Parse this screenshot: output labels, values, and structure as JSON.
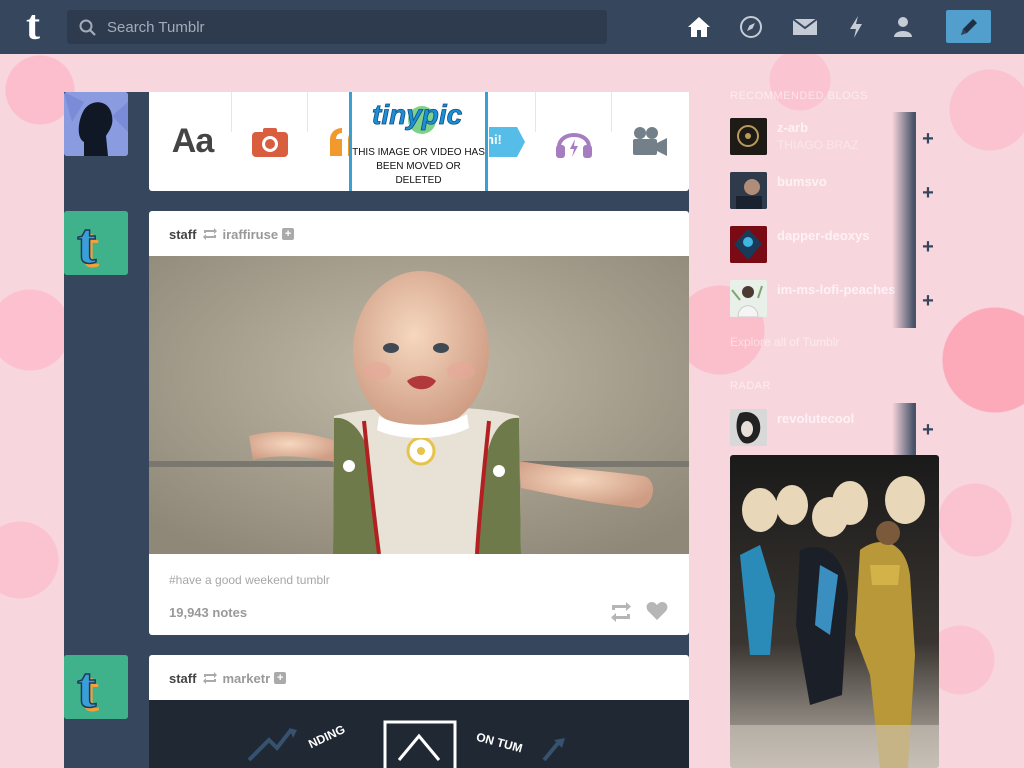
{
  "search": {
    "placeholder": "Search Tumblr"
  },
  "nav": {
    "home": "home-icon",
    "explore": "compass-icon",
    "inbox": "envelope-icon",
    "activity": "lightning-icon",
    "account": "person-icon",
    "compose": "pencil-icon"
  },
  "colors": {
    "topbar": "#36465d",
    "accent": "#529ecc",
    "background": "#f8d6de"
  },
  "post_types": {
    "text": "Aa",
    "chat": "hi!",
    "broken_image": "THIS IMAGE OR VIDEO HAS BEEN MOVED OR DELETED",
    "broken_logo": "tinypic"
  },
  "posts": [
    {
      "author": "staff",
      "source": "iraffiruse",
      "tags": "#have a good weekend tumblr",
      "notes": "19,943 notes"
    },
    {
      "author": "staff",
      "source": "marketr",
      "banner_words": [
        "NDING",
        "ON TUM"
      ]
    }
  ],
  "sidebar": {
    "recommended_header": "RECOMMENDED BLOGS",
    "recommended": [
      {
        "name": "z-arb",
        "sub": "THIAGO BRAZ"
      },
      {
        "name": "bumsvo",
        "sub": ""
      },
      {
        "name": "dapper-deoxys",
        "sub": ""
      },
      {
        "name": "im-ms-lofi-peaches",
        "sub": ""
      }
    ],
    "explore_link": "Explore all of Tumblr",
    "radar_header": "RADAR",
    "radar_blog": {
      "name": "revolutecool",
      "sub": ""
    }
  }
}
